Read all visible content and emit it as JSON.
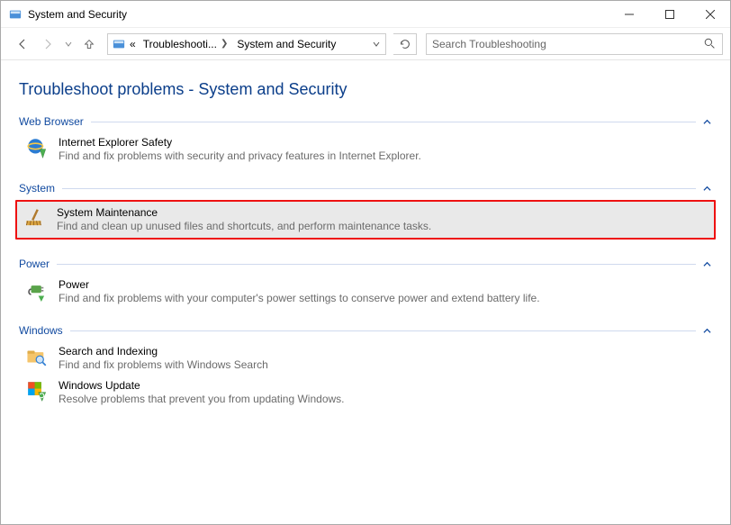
{
  "window": {
    "title": "System and Security"
  },
  "breadcrumb": {
    "prefix": "«",
    "part1": "Troubleshooti...",
    "part2": "System and Security"
  },
  "search": {
    "placeholder": "Search Troubleshooting"
  },
  "page": {
    "title": "Troubleshoot problems - System and Security"
  },
  "sections": [
    {
      "label": "Web Browser",
      "items": [
        {
          "title": "Internet Explorer Safety",
          "desc": "Find and fix problems with security and privacy features in Internet Explorer.",
          "icon": "ie-shield-icon",
          "highlight": false
        }
      ]
    },
    {
      "label": "System",
      "items": [
        {
          "title": "System Maintenance",
          "desc": "Find and clean up unused files and shortcuts, and perform maintenance tasks.",
          "icon": "broom-icon",
          "highlight": true
        }
      ]
    },
    {
      "label": "Power",
      "items": [
        {
          "title": "Power",
          "desc": "Find and fix problems with your computer's power settings to conserve power and extend battery life.",
          "icon": "power-plug-icon",
          "highlight": false
        }
      ]
    },
    {
      "label": "Windows",
      "items": [
        {
          "title": "Search and Indexing",
          "desc": "Find and fix problems with Windows Search",
          "icon": "search-folder-icon",
          "highlight": false
        },
        {
          "title": "Windows Update",
          "desc": "Resolve problems that prevent you from updating Windows.",
          "icon": "update-shield-icon",
          "highlight": false
        }
      ]
    }
  ]
}
